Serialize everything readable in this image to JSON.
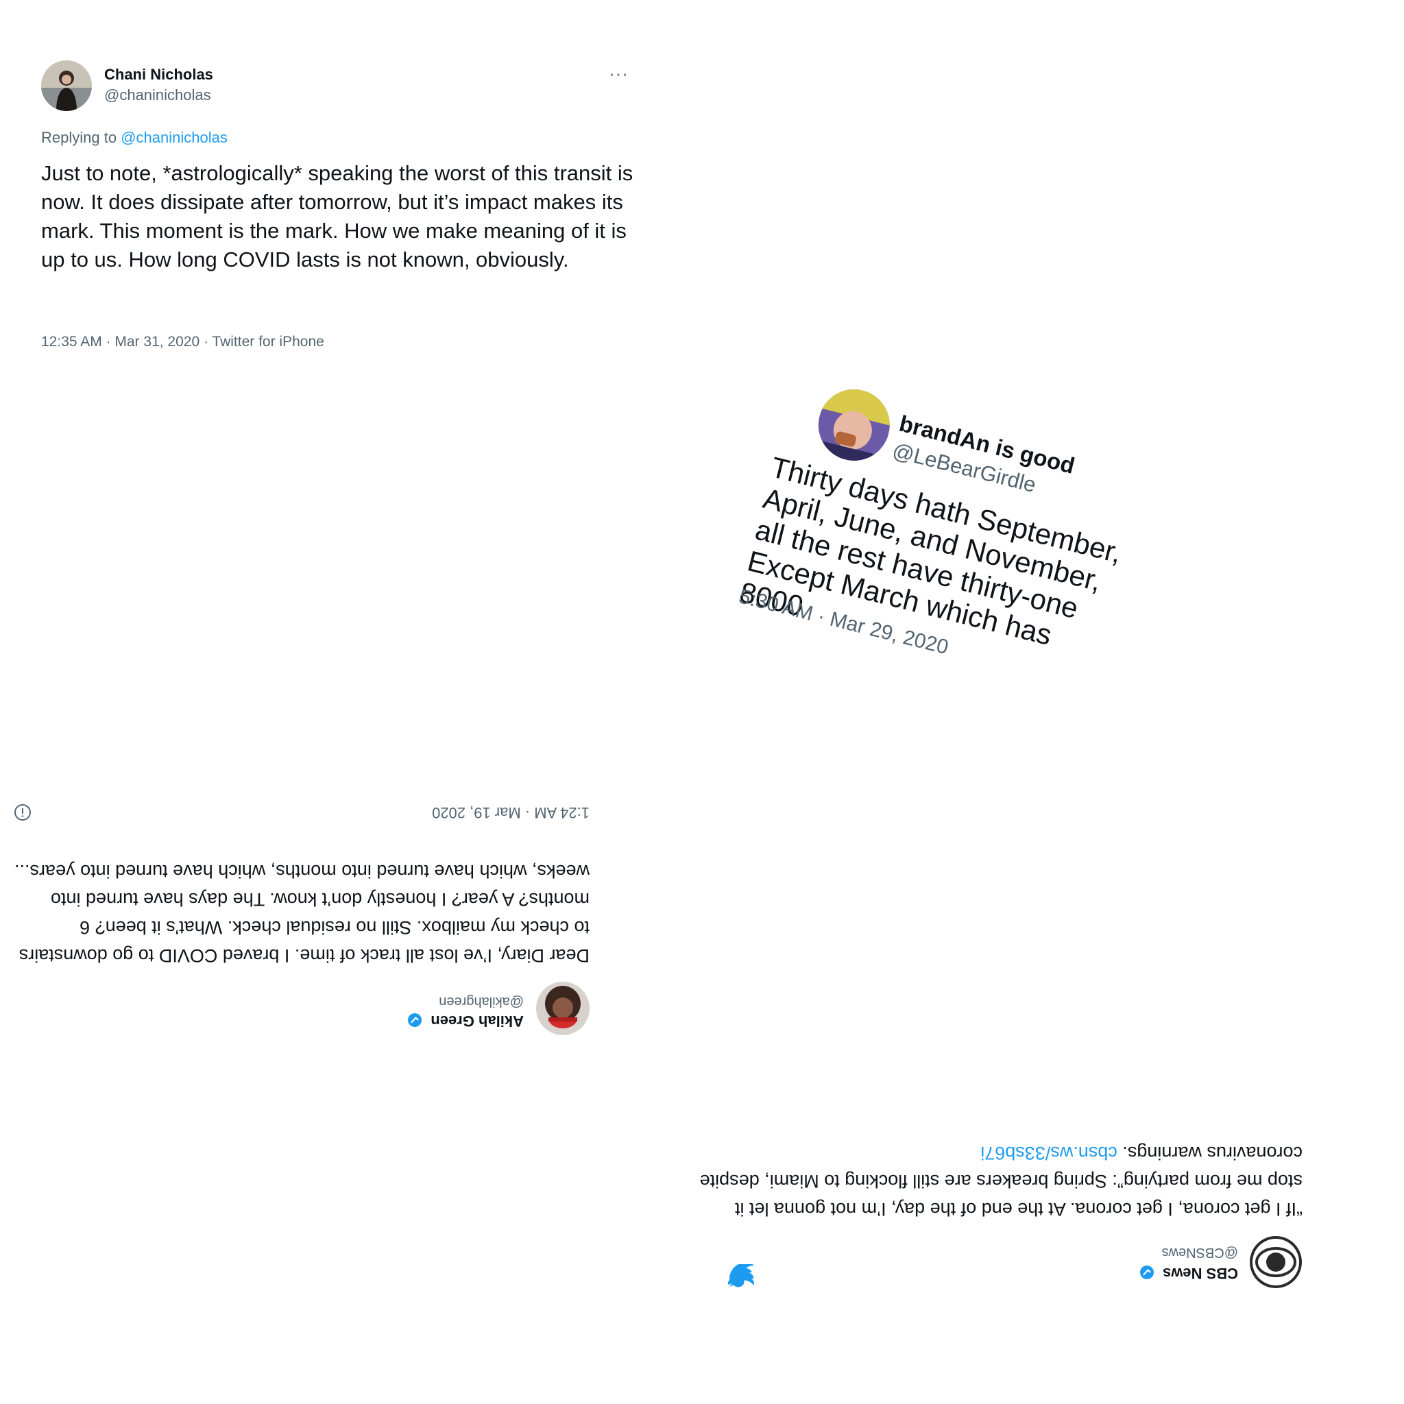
{
  "colors": {
    "text": "#0f1419",
    "secondary": "#536471",
    "link": "#1d9bf0",
    "verified": "#1d9bf0"
  },
  "tweets": [
    {
      "name": "Chani Nicholas",
      "handle": "@chaninicholas",
      "more_icon": "more-horizontal-icon",
      "reply_prefix": "Replying to",
      "reply_handle": "@chaninicholas",
      "text": "Just to note, *astrologically* speaking the worst of this transit is now. It does dissipate after tomorrow, but it’s impact makes its mark. This moment is the mark. How we make meaning of it is up to us. How long COVID lasts is not known, obviously.",
      "meta": "12:35 AM · Mar 31, 2020 · Twitter for iPhone"
    },
    {
      "name": "brandAn is good",
      "handle": "@LeBearGirdle",
      "lines": [
        "Thirty days hath September,",
        "April, June, and November,",
        "all the rest have thirty-one",
        "Except March which has 8000"
      ],
      "meta": "5:30 AM · Mar 29, 2020"
    },
    {
      "name": "Akilah Green",
      "handle": "@akilahgreen",
      "verified": true,
      "text": "Dear Diary, I’ve lost all track of time. I braved COVID to go downstairs to check my mailbox. Still no residual check. What’s it been? 6 months? A year? I honestly don’t know. The days have turned into weeks, which have turned into months, which have turned into years...",
      "meta": "1:24 AM · Mar 19, 2020",
      "info_icon": "info-icon"
    },
    {
      "name": "CBS News",
      "handle": "@CBSNews",
      "verified": true,
      "text": "“If I get corona, I get corona. At the end of the day, I’m not gonna let it stop me from partying”: Spring breakers are still flocking to Miami, despite coronavirus warnings.",
      "link": "cbsn.ws/33sb67i",
      "bird_icon": "twitter-bird-icon"
    }
  ]
}
